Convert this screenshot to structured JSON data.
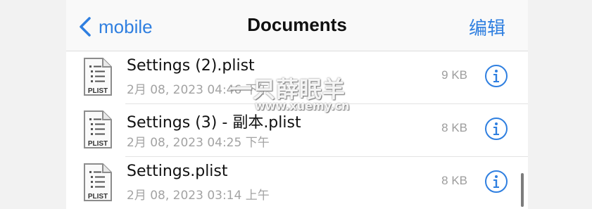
{
  "colors": {
    "accent": "#2f7fe0",
    "secondary_text": "#a3a3a3",
    "separator": "#e3e3e3"
  },
  "navbar": {
    "back_label": "mobile",
    "title": "Documents",
    "edit_label": "编辑"
  },
  "files": [
    {
      "name": "Settings (2).plist",
      "date": "2月 08, 2023 04:46 下午",
      "size": "9 KB",
      "icon_text": "PLIST"
    },
    {
      "name": "Settings (3) - 副本.plist",
      "date": "2月 08, 2023 04:25 下午",
      "size": "8 KB",
      "icon_text": "PLIST"
    },
    {
      "name": "Settings.plist",
      "date": "2月 08, 2023 03:14 上午",
      "size": "8 KB",
      "icon_text": "PLIST"
    }
  ],
  "watermark": {
    "text": "一只薛眠羊",
    "url": "www.xuemy.cn"
  },
  "icons": {
    "back": "chevron-left-icon",
    "file": "plist-file-icon",
    "info": "info-circle-icon"
  }
}
